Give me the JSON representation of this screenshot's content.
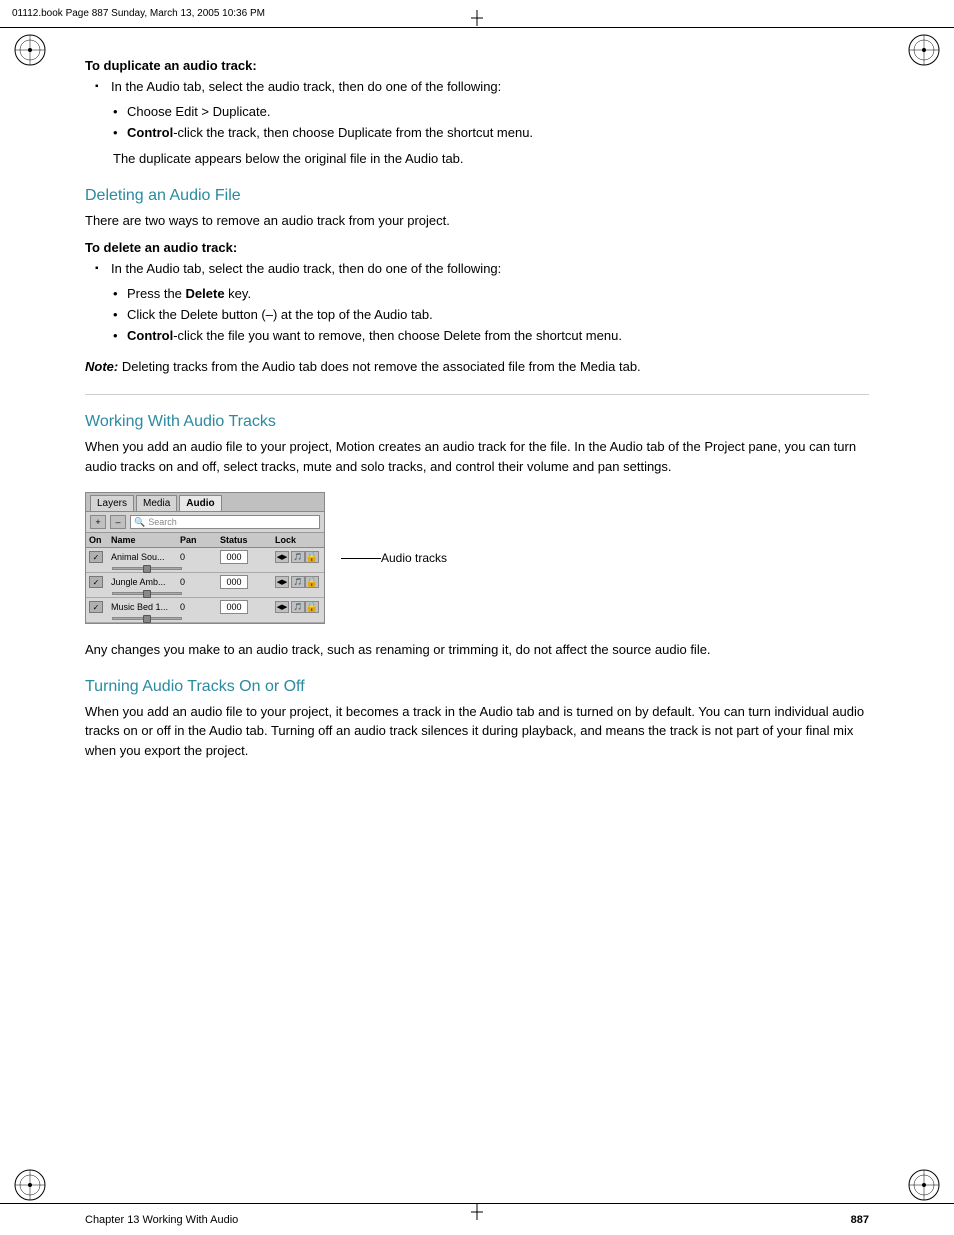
{
  "header": {
    "text": "01112.book  Page 887  Sunday, March 13, 2005  10:36 PM"
  },
  "footer": {
    "chapter_label": "Chapter 13    Working With Audio",
    "page_number": "887"
  },
  "content": {
    "duplicate_section": {
      "bold_label": "To duplicate an audio track:",
      "bullet_top": "In the Audio tab, select the audio track, then do one of the following:",
      "sub_bullets": [
        "Choose Edit > Duplicate.",
        "Control-click the track, then choose Duplicate from the shortcut menu."
      ],
      "trailing_text": "The duplicate appears below the original file in the Audio tab."
    },
    "deleting_section": {
      "heading": "Deleting an Audio File",
      "intro": "There are two ways to remove an audio track from your project.",
      "bold_label": "To delete an audio track:",
      "bullet_top": "In the Audio tab, select the audio track, then do one of the following:",
      "sub_bullets": [
        "Press the Delete key.",
        "Click the Delete button (–) at the top of the Audio tab.",
        "Control-click the file you want to remove, then choose Delete from the shortcut menu."
      ],
      "note_label": "Note:",
      "note_text": "  Deleting tracks from the Audio tab does not remove the associated file from the Media tab."
    },
    "working_section": {
      "heading": "Working With Audio Tracks",
      "intro": "When you add an audio file to your project, Motion creates an audio track for the file. In the Audio tab of the Project pane, you can turn audio tracks on and off, select tracks, mute and solo tracks, and control their volume and pan settings.",
      "figure": {
        "tabs": [
          "Layers",
          "Media",
          "Audio"
        ],
        "active_tab": "Audio",
        "toolbar": {
          "plus_btn": "+",
          "minus_btn": "–",
          "search_placeholder": "Search"
        },
        "columns": [
          "On",
          "Name",
          "Pan",
          "Status",
          "Lock",
          ""
        ],
        "tracks": [
          {
            "name": "Animal Sou...",
            "pan_value": "0",
            "pan_display": "000",
            "on": true
          },
          {
            "name": "Jungle Amb...",
            "pan_value": "0",
            "pan_display": "000",
            "on": true
          },
          {
            "name": "Music Bed 1...",
            "pan_value": "0",
            "pan_display": "000",
            "on": true
          }
        ],
        "callout_label": "Audio tracks"
      },
      "after_figure_text": "Any changes you make to an audio track, such as renaming or trimming it, do not affect the source audio file."
    },
    "turning_section": {
      "heading": "Turning Audio Tracks On or Off",
      "intro": "When you add an audio file to your project, it becomes a track in the Audio tab and is turned on by default. You can turn individual audio tracks on or off in the Audio tab. Turning off an audio track silences it during playback, and means the track is not part of your final mix when you export the project."
    }
  }
}
